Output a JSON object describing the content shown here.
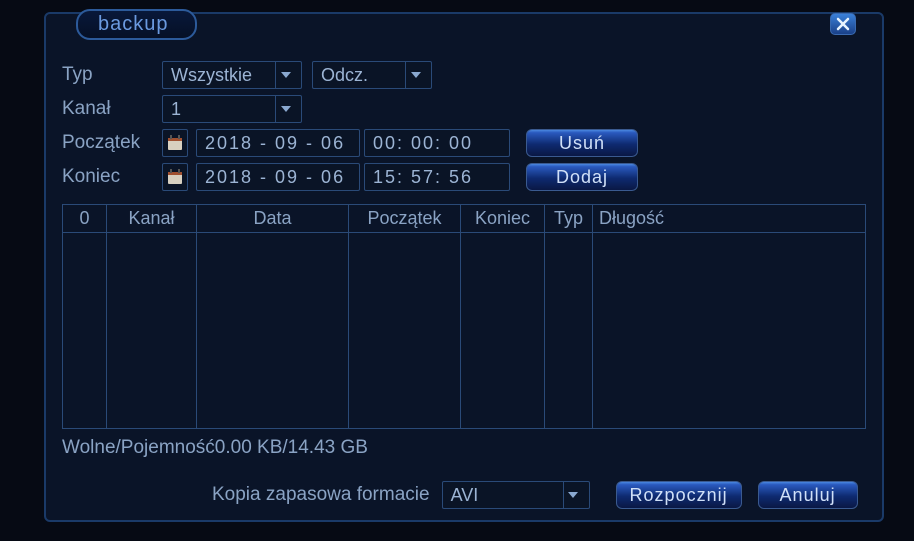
{
  "window": {
    "title": "backup"
  },
  "form": {
    "typ_label": "Typ",
    "typ_value": "Wszystkie",
    "reader_value": "Odcz.",
    "kanal_label": "Kanał",
    "kanal_value": "1",
    "start_label": "Początek",
    "start_date": "2018 - 09 - 06",
    "start_time": "00: 00: 00",
    "end_label": "Koniec",
    "end_date": "2018 - 09 - 06",
    "end_time": "15: 57: 56",
    "remove_btn": "Usuń",
    "add_btn": "Dodaj"
  },
  "table": {
    "headers": {
      "idx": "0",
      "kanal": "Kanał",
      "data": "Data",
      "start": "Początek",
      "end": "Koniec",
      "typ": "Typ",
      "length": "Długość"
    },
    "rows": []
  },
  "capacity_text": "Wolne/Pojemność0.00 KB/14.43 GB",
  "footer": {
    "format_label": "Kopia zapasowa formacie",
    "format_value": "AVI",
    "start_btn": "Rozpocznij",
    "cancel_btn": "Anuluj"
  }
}
